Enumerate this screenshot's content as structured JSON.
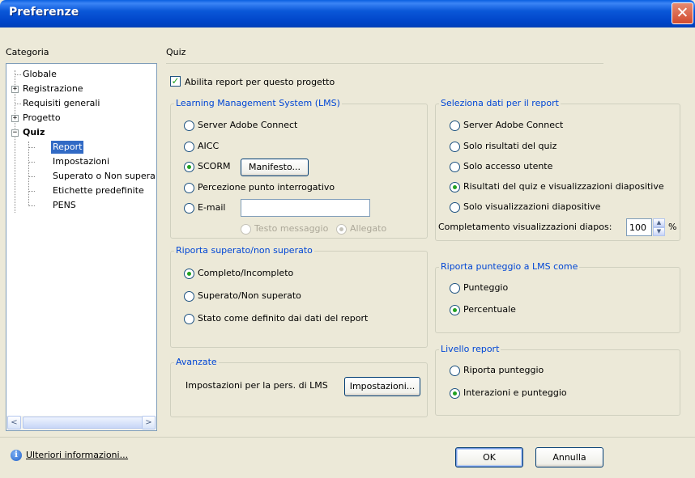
{
  "window": {
    "title": "Preferenze",
    "close_glyph": "✕"
  },
  "sidebar": {
    "label": "Categoria",
    "items": [
      {
        "label": "Globale"
      },
      {
        "label": "Registrazione",
        "expander": "+"
      },
      {
        "label": "Requisiti generali"
      },
      {
        "label": "Progetto",
        "expander": "+"
      },
      {
        "label": "Quiz",
        "expander": "−"
      },
      {
        "label": "Report",
        "selected": true
      },
      {
        "label": "Impostazioni"
      },
      {
        "label": "Superato o Non supera"
      },
      {
        "label": "Etichette predefinite"
      },
      {
        "label": "PENS"
      }
    ],
    "scroll_left": "<",
    "scroll_right": ">"
  },
  "panel": {
    "title": "Quiz",
    "enable_report": {
      "label": "Abilita report per questo progetto",
      "checked": true
    }
  },
  "lms": {
    "legend": "Learning Management System (LMS)",
    "options": [
      {
        "label": "Server Adobe Connect",
        "checked": false
      },
      {
        "label": "AICC",
        "checked": false
      },
      {
        "label": "SCORM",
        "checked": true
      },
      {
        "label": "Percezione punto interrogativo",
        "checked": false
      },
      {
        "label": "E-mail",
        "checked": false
      }
    ],
    "manifest_button": "Manifesto...",
    "email_value": "",
    "sub_options": [
      {
        "label": "Testo messaggio",
        "checked": false,
        "disabled": true
      },
      {
        "label": "Allegato",
        "checked": true,
        "disabled": true
      }
    ]
  },
  "report_data": {
    "legend": "Seleziona dati per il report",
    "options": [
      {
        "label": "Server Adobe Connect",
        "checked": false
      },
      {
        "label": "Solo risultati del quiz",
        "checked": false
      },
      {
        "label": "Solo accesso utente",
        "checked": false
      },
      {
        "label": "Risultati del quiz e visualizzazioni diapositive",
        "checked": true
      },
      {
        "label": "Solo visualizzazioni diapositive",
        "checked": false
      }
    ],
    "completion_label": "Completamento visualizzazioni diapos:",
    "completion_value": "100",
    "completion_unit": "%"
  },
  "pass_fail": {
    "legend": "Riporta superato/non superato",
    "options": [
      {
        "label": "Completo/Incompleto",
        "checked": true
      },
      {
        "label": "Superato/Non superato",
        "checked": false
      },
      {
        "label": "Stato come definito dai dati del report",
        "checked": false
      }
    ]
  },
  "score_as": {
    "legend": "Riporta punteggio a LMS come",
    "options": [
      {
        "label": "Punteggio",
        "checked": false
      },
      {
        "label": "Percentuale",
        "checked": true
      }
    ]
  },
  "advanced": {
    "legend": "Avanzate",
    "label": "Impostazioni per la pers. di LMS",
    "button": "Impostazioni..."
  },
  "report_level": {
    "legend": "Livello report",
    "options": [
      {
        "label": "Riporta punteggio",
        "checked": false
      },
      {
        "label": "Interazioni e punteggio",
        "checked": true
      }
    ]
  },
  "footer": {
    "info_link": "Ulteriori informazioni...",
    "ok": "OK",
    "cancel": "Annulla"
  }
}
